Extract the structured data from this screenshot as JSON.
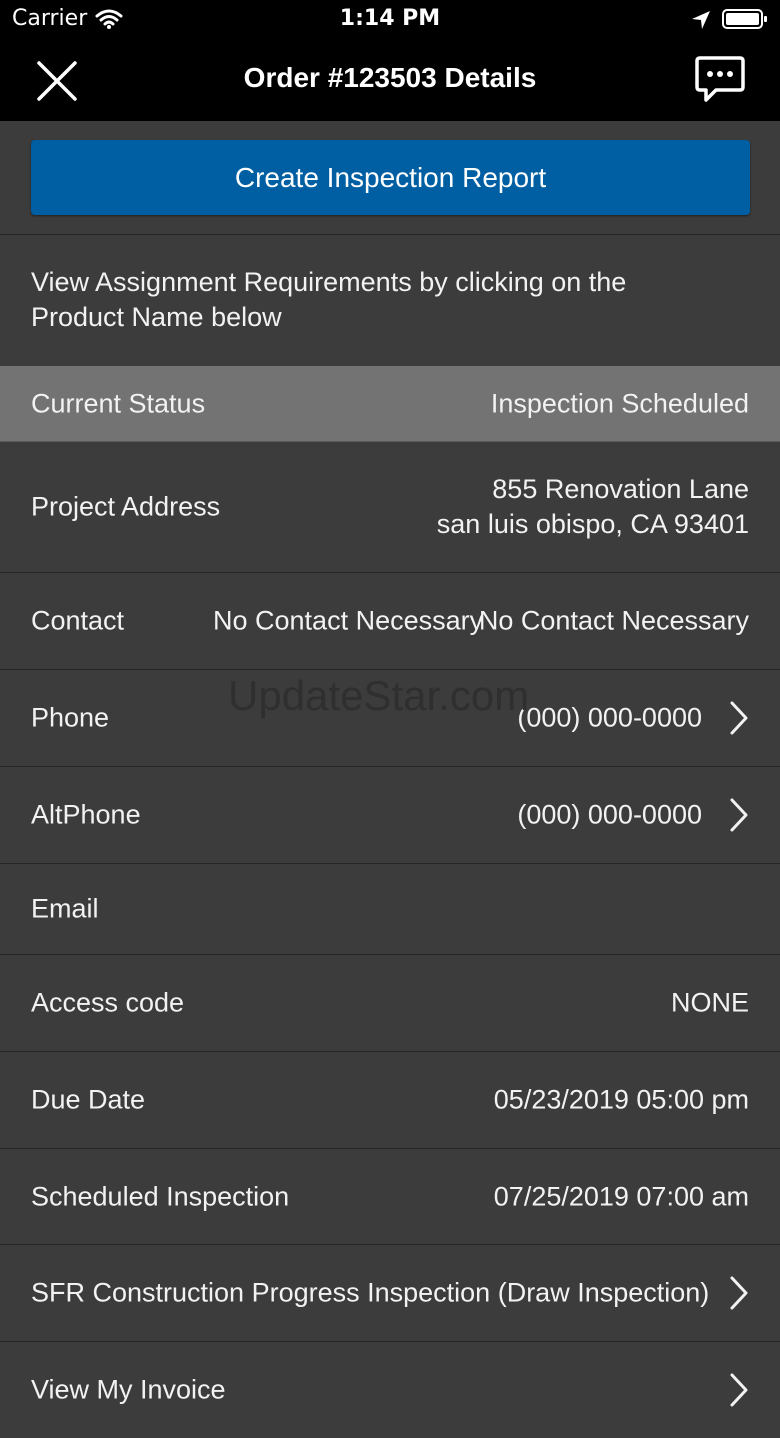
{
  "statusbar": {
    "carrier": "Carrier",
    "time": "1:14 PM"
  },
  "navbar": {
    "title": "Order #123503 Details"
  },
  "actions": {
    "create_report": "Create Inspection Report"
  },
  "info_text": "View Assignment Requirements by clicking on the Product Name below",
  "current_status": {
    "label": "Current Status",
    "value": "Inspection Scheduled"
  },
  "project_address": {
    "label": "Project Address",
    "line1": "855 Renovation Lane",
    "line2": "san luis obispo, CA 93401"
  },
  "contact": {
    "label": "Contact",
    "value1": "No Contact Necessary",
    "value2": "No Contact Necessary"
  },
  "phone": {
    "label": "Phone",
    "value": "(000) 000-0000"
  },
  "altphone": {
    "label": "AltPhone",
    "value": "(000) 000-0000"
  },
  "email": {
    "label": "Email",
    "value": ""
  },
  "access_code": {
    "label": "Access code",
    "value": "NONE"
  },
  "due_date": {
    "label": "Due Date",
    "value": "05/23/2019 05:00 pm"
  },
  "scheduled_inspection": {
    "label": "Scheduled Inspection",
    "value": "07/25/2019 07:00 am"
  },
  "product": {
    "label": "SFR Construction Progress Inspection (Draw Inspection)"
  },
  "invoice": {
    "label": "View My Invoice"
  },
  "watermark": "UpdateStar.com",
  "colors": {
    "accent": "#005fa3",
    "background": "#3c3c3c",
    "status_row": "#737373",
    "bars": "#000000"
  }
}
